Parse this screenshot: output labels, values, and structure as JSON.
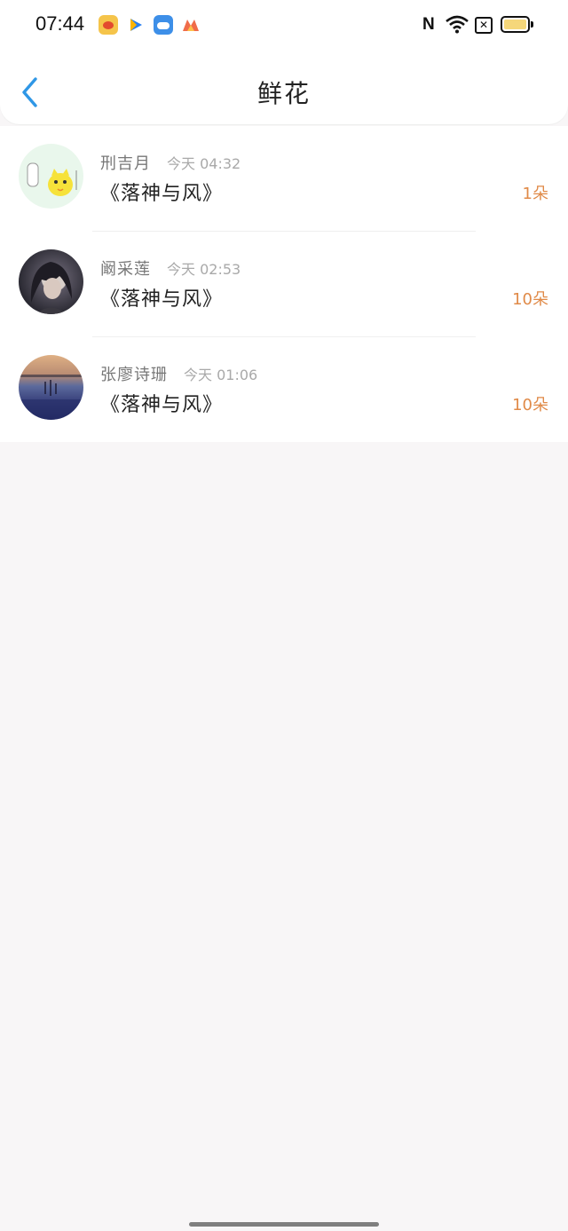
{
  "status_bar": {
    "time": "07:44",
    "apps": [
      "weibo-icon",
      "play-arrow-icon",
      "weather-icon",
      "m-app-icon"
    ],
    "nfc": "N",
    "sim": "✕",
    "battery_color": "#f5d77a"
  },
  "header": {
    "title": "鲜花"
  },
  "flowers": [
    {
      "name": "刑吉月",
      "time": "今天 04:32",
      "book": "《落神与风》",
      "count": "1朵"
    },
    {
      "name": "阚采莲",
      "time": "今天 02:53",
      "book": "《落神与风》",
      "count": "10朵"
    },
    {
      "name": "张廖诗珊",
      "time": "今天 01:06",
      "book": "《落神与风》",
      "count": "10朵"
    }
  ],
  "colors": {
    "accent": "#2f97e6",
    "count": "#e08a48",
    "background": "#f8f6f7"
  }
}
